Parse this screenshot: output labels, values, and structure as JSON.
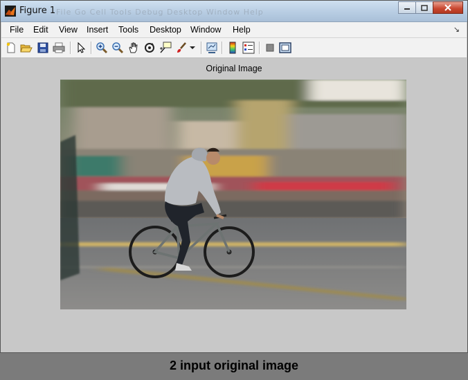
{
  "window": {
    "title": "Figure 1",
    "ghost_menu": "File   Go   Cell   Tools   Debug   Desktop   Window   Help"
  },
  "menubar": {
    "items": [
      "File",
      "Edit",
      "View",
      "Insert",
      "Tools",
      "Desktop",
      "Window",
      "Help"
    ]
  },
  "toolbar": {
    "icons": [
      "new-figure-icon",
      "open-file-icon",
      "save-icon",
      "print-icon",
      "edit-plot-arrow-icon",
      "zoom-in-icon",
      "zoom-out-icon",
      "pan-hand-icon",
      "rotate-3d-icon",
      "data-cursor-icon",
      "brush-icon",
      "brush-dropdown-icon",
      "link-plot-icon",
      "colorbar-icon",
      "legend-icon",
      "hide-plot-tools-icon",
      "show-plot-tools-icon"
    ]
  },
  "axes": {
    "title": "Original Image"
  },
  "caption": "2 input original image",
  "colors": {
    "figure_bg": "#c8c8c8",
    "titlebar": "#b8cde3",
    "caption_band": "#7b7b7b"
  }
}
